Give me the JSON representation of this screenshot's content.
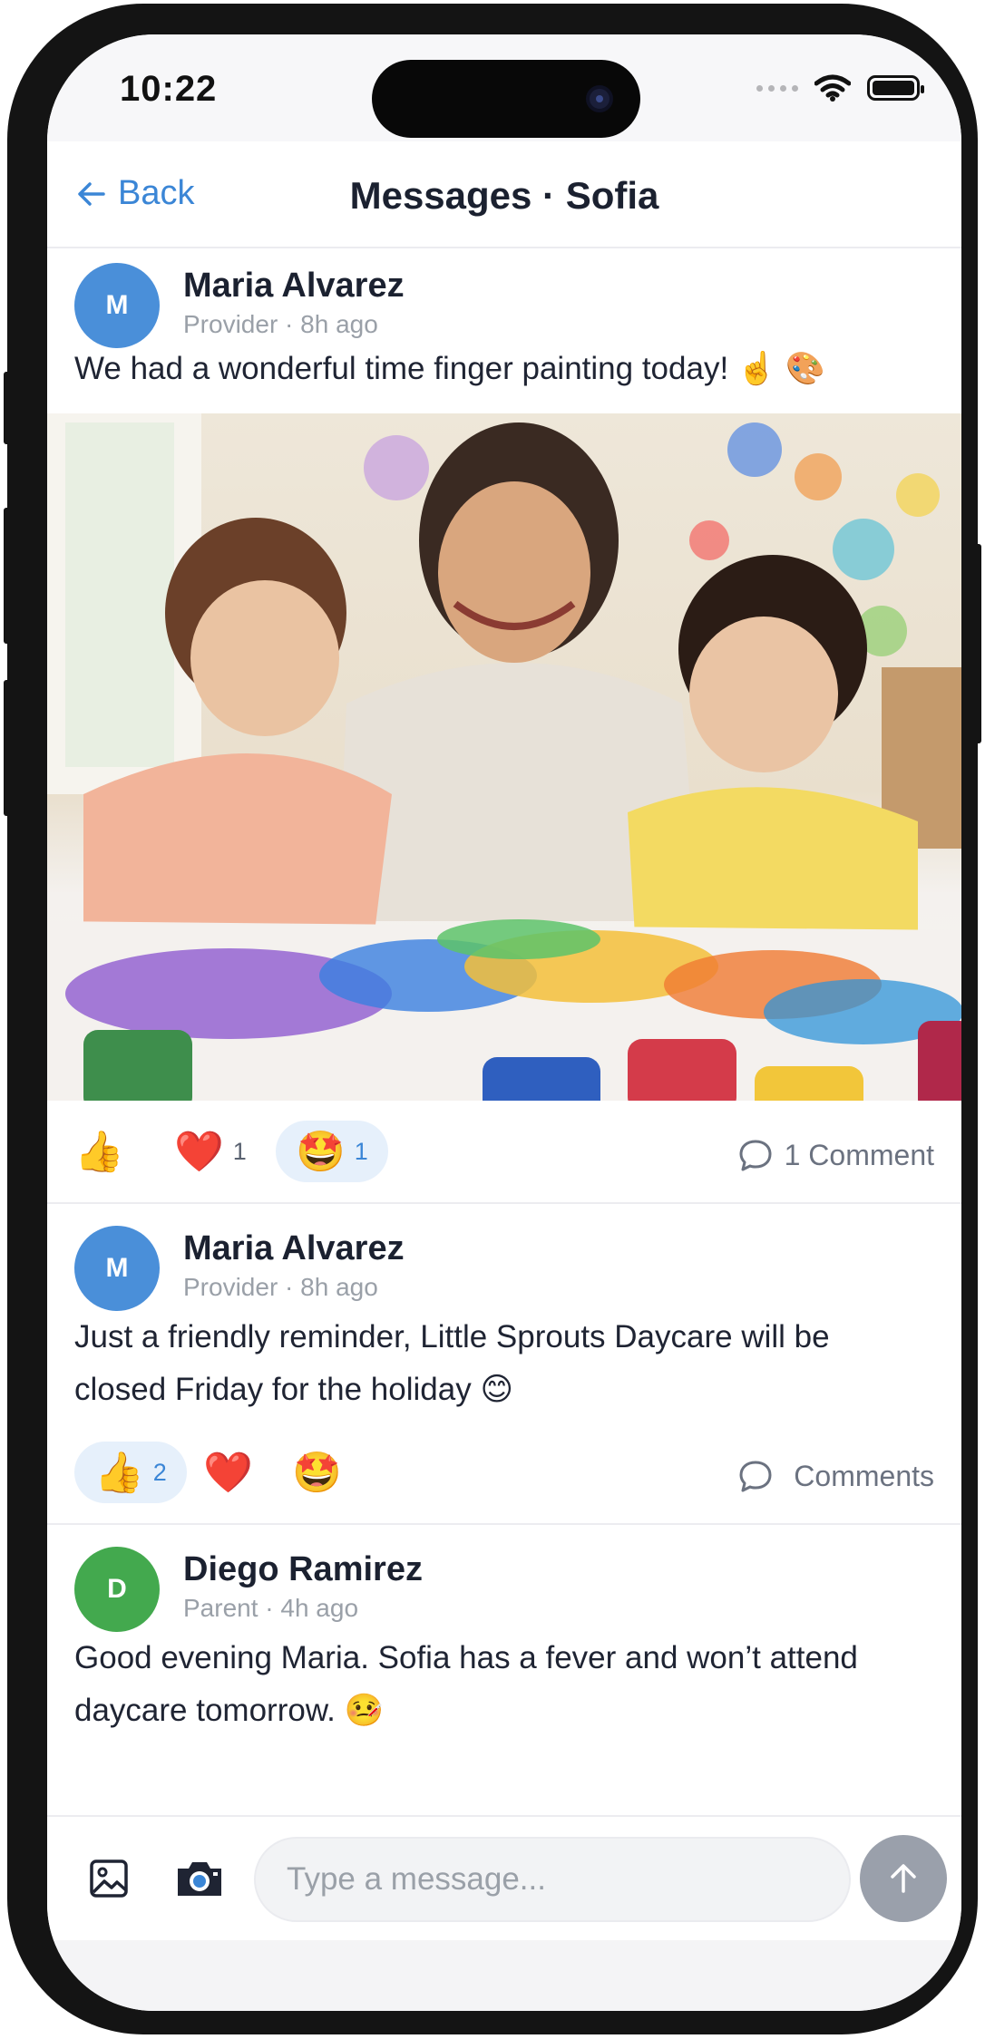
{
  "status_bar": {
    "time": "10:22"
  },
  "nav": {
    "back_label": "Back",
    "title": "Messages · Sofia"
  },
  "posts": [
    {
      "avatar_initial": "M",
      "avatar_color": "#4a8fd9",
      "author": "Maria Alvarez",
      "meta": "Provider · 8h ago",
      "text": "We had a wonderful time finger painting today! ☝️ 🎨",
      "has_photo": true,
      "reactions": [
        {
          "icon": "thumbs-up-icon",
          "emoji": "👍",
          "count": ""
        },
        {
          "icon": "heart-icon",
          "emoji": "❤️",
          "count": "1"
        },
        {
          "icon": "star-struck-icon",
          "emoji": "🤩",
          "count": "1",
          "selected": true
        }
      ],
      "comments_label": "1 Comment"
    },
    {
      "avatar_initial": "M",
      "avatar_color": "#4a8fd9",
      "author": "Maria Alvarez",
      "meta": "Provider · 8h ago",
      "text": "Just a friendly reminder, Little Sprouts Daycare will be closed Friday for the holiday 😊",
      "has_photo": false,
      "reactions": [
        {
          "icon": "thumbs-up-icon",
          "emoji": "👍",
          "count": "2",
          "selected": true
        },
        {
          "icon": "heart-icon",
          "emoji": "❤️",
          "count": ""
        },
        {
          "icon": "star-struck-icon",
          "emoji": "🤩",
          "count": ""
        }
      ],
      "comments_label": "Comments"
    },
    {
      "avatar_initial": "D",
      "avatar_color": "#43a94e",
      "author": "Diego Ramirez",
      "meta": "Parent · 4h ago",
      "text": "Good evening Maria. Sofia has a fever and won’t attend daycare tomorrow. 🤒"
    }
  ],
  "composer": {
    "placeholder": "Type a message...",
    "gallery_icon": "image-icon",
    "camera_icon": "camera-icon",
    "send_icon": "arrow-up-icon"
  },
  "colors": {
    "accent": "#3b86d6",
    "pill_bg": "#e6f0fb",
    "send_bg": "#9aa0ab"
  }
}
